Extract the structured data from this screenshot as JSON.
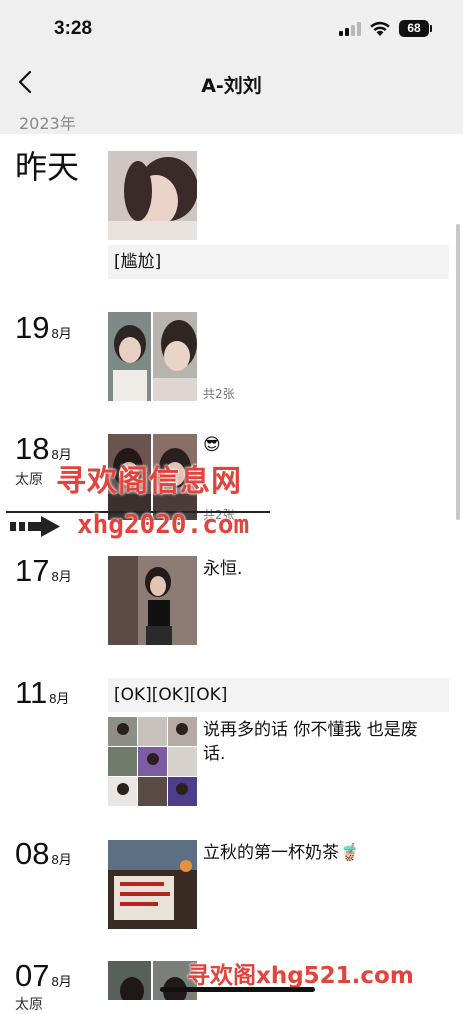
{
  "status": {
    "time": "3:28",
    "battery": "68"
  },
  "nav": {
    "title": "A-刘刘"
  },
  "year": "2023年",
  "entries": [
    {
      "day": "昨天",
      "text": "[尴尬]"
    },
    {
      "day": "19",
      "month": "8月",
      "count": "共2张"
    },
    {
      "day": "18",
      "month": "8月",
      "location": "太原",
      "emoji": "😎",
      "count": "共2张"
    },
    {
      "day": "17",
      "month": "8月",
      "caption": "永恒."
    },
    {
      "day": "11",
      "month": "8月",
      "text": "[OK][OK][OK]",
      "caption_line1": "说再多的话 你不懂我 也是废",
      "caption_line2": "话."
    },
    {
      "day": "08",
      "month": "8月",
      "caption": "立秋的第一杯奶茶",
      "emoji": "🧋"
    },
    {
      "day": "07",
      "month": "8月",
      "location": "太原"
    }
  ],
  "watermarks": {
    "top_cn": "寻欢阁信息网",
    "top_url": "xhg2020.com",
    "bottom": "寻欢阁xhg521.com"
  }
}
